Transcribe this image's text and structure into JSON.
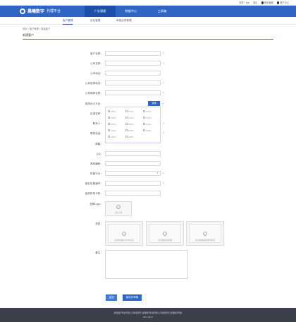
{
  "topbar": {
    "user_text": "您好！test",
    "exit_label": "退出",
    "contact_label": "联系客服",
    "account_label": "账户中心"
  },
  "header": {
    "logo_text": "晨曦数字",
    "logo_sub": "代理平台",
    "nav": [
      {
        "label": "广告管理"
      },
      {
        "label": "数据中心"
      },
      {
        "label": "工具箱"
      }
    ]
  },
  "subnav": {
    "tabs": [
      {
        "label": "客户管理"
      },
      {
        "label": "优化管理"
      },
      {
        "label": "审核记录管理"
      }
    ]
  },
  "breadcrumb": "首页 > 客户管理 > 新建客户",
  "page_title": "新建客户",
  "form": {
    "labels": {
      "customer_name": "客户名称：",
      "company_name": "公司名称：",
      "company_addr": "公司地址：",
      "company_site": "公司官网地址：",
      "company_short": "公司简称名称：",
      "adx": "选择ADX平台：",
      "region": "区域名称：",
      "contact": "联系人：",
      "phone": "联系电话：",
      "email": "邮箱：",
      "qq": "QQ：",
      "zip": "邮政编码：",
      "industry": "所属行业：",
      "license_no": "营业执照编号：",
      "org_code": "组织机构代码：",
      "brand_logo": "品牌Logo：",
      "qualification": "资质：",
      "remark": "备注："
    },
    "select_label": "选择",
    "adx_option": "XXPAI",
    "industry_arrow": "▼",
    "upload_label": "点击上传",
    "tiles": [
      "点击添加客户ICP许可证",
      "点击添加营业执照",
      "点击添加组织机构代码证"
    ],
    "required_mark": "*",
    "back_label": "返回",
    "save_label": "保存并审核"
  },
  "footer": {
    "line1": "晨曦数字科技有限公司版权所有 晨曦数字科技有限公司版权所有 晨曦数字科技",
    "line2": "2017-08-27"
  }
}
